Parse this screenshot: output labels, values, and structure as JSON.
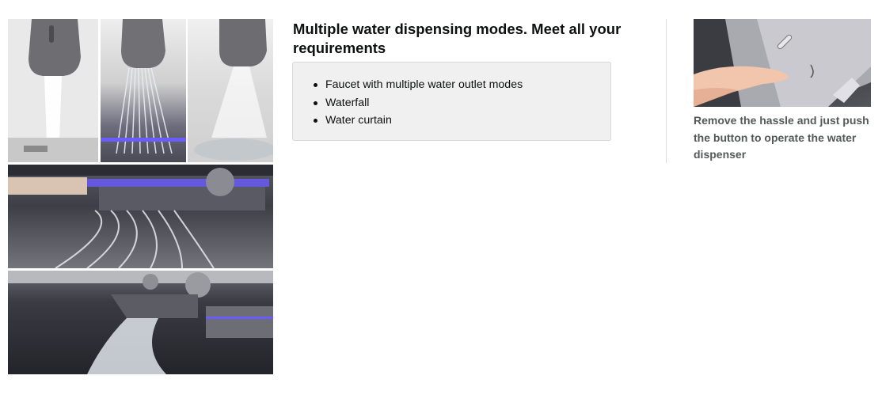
{
  "headline": "Multiple water dispensing modes. Meet all your requirements",
  "features": [
    {
      "label": "Faucet with multiple water outlet modes"
    },
    {
      "label": "Waterfall"
    },
    {
      "label": "Water curtain"
    }
  ],
  "right_card": {
    "caption": "Remove the hassle and just push the button to operate the water dispenser"
  },
  "colors": {
    "text_primary": "#0f1111",
    "text_secondary": "#565959",
    "box_bg": "#f0f0f0",
    "box_border": "#d5d9d9",
    "divider": "#dddddd",
    "accent_led": "#6a5cff"
  },
  "images": {
    "collage": "sink-faucet-water-modes-collage",
    "right": "hand-pressing-button-on-sink-panel"
  }
}
